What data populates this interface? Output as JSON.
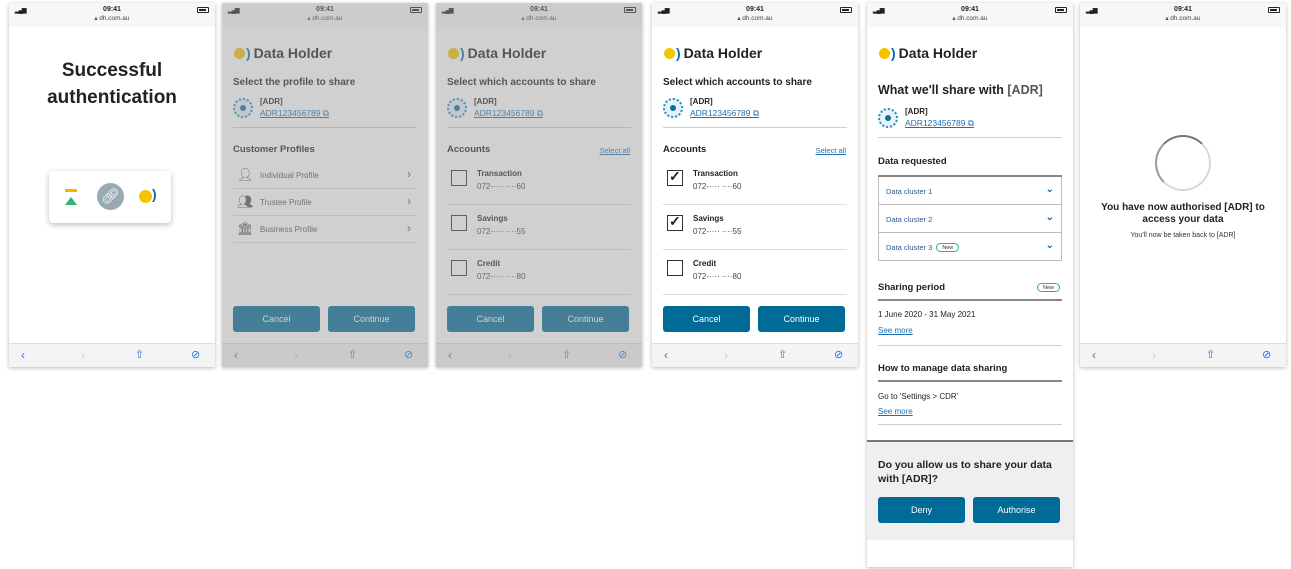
{
  "status": {
    "time": "09:41",
    "url": "dh.com.au"
  },
  "brand": {
    "name": "Data Holder"
  },
  "adr": {
    "name": "[ADR]",
    "id": "ADR123456789"
  },
  "screen1": {
    "title": "Successful authentication"
  },
  "screen2": {
    "heading": "Select the profile to share",
    "section": "Customer Profiles",
    "profiles": [
      "Individual Profile",
      "Trustee Profile",
      "Business Profile"
    ],
    "cancel": "Cancel",
    "continue": "Continue"
  },
  "screen3": {
    "heading": "Select which accounts to share",
    "section": "Accounts",
    "select_all": "Select all",
    "accounts": [
      {
        "name": "Transaction",
        "number": "072-···· ····60"
      },
      {
        "name": "Savings",
        "number": "072-···· ····55"
      },
      {
        "name": "Credit",
        "number": "072-···· ····80"
      }
    ],
    "cancel": "Cancel",
    "continue": "Continue"
  },
  "screen4": {
    "heading": "Select which accounts to share",
    "section": "Accounts",
    "select_all": "Select all",
    "accounts": [
      {
        "name": "Transaction",
        "number": "072-···· ····60",
        "checked": true
      },
      {
        "name": "Savings",
        "number": "072-···· ····55",
        "checked": true
      },
      {
        "name": "Credit",
        "number": "072-···· ····80",
        "checked": false
      }
    ],
    "cancel": "Cancel",
    "continue": "Continue"
  },
  "screen5": {
    "heading_prefix": "What we'll share with ",
    "heading_adr": "[ADR]",
    "data_requested": "Data requested",
    "clusters": [
      "Data cluster 1",
      "Data cluster 2",
      "Data cluster 3"
    ],
    "new_badge": "New",
    "sharing_period": "Sharing period",
    "period": "1 June  2020 - 31 May 2021",
    "see_more": "See more",
    "manage": "How to manage data sharing",
    "manage_text": "Go to 'Settings > CDR'",
    "consent_question": "Do you allow us to share your data with [ADR]?",
    "deny": "Deny",
    "authorise": "Authorise"
  },
  "screen6": {
    "title": "You have now authorised [ADR] to access your data",
    "subtitle": "You'll now be taken back to [ADR]"
  },
  "toolbar": {
    "back": "‹",
    "forward": "›",
    "share": "⇧",
    "compass": "⊘"
  },
  "colors": {
    "primary": "#006b97",
    "brand_yellow": "#f5c400",
    "link": "#1d6fb3"
  }
}
